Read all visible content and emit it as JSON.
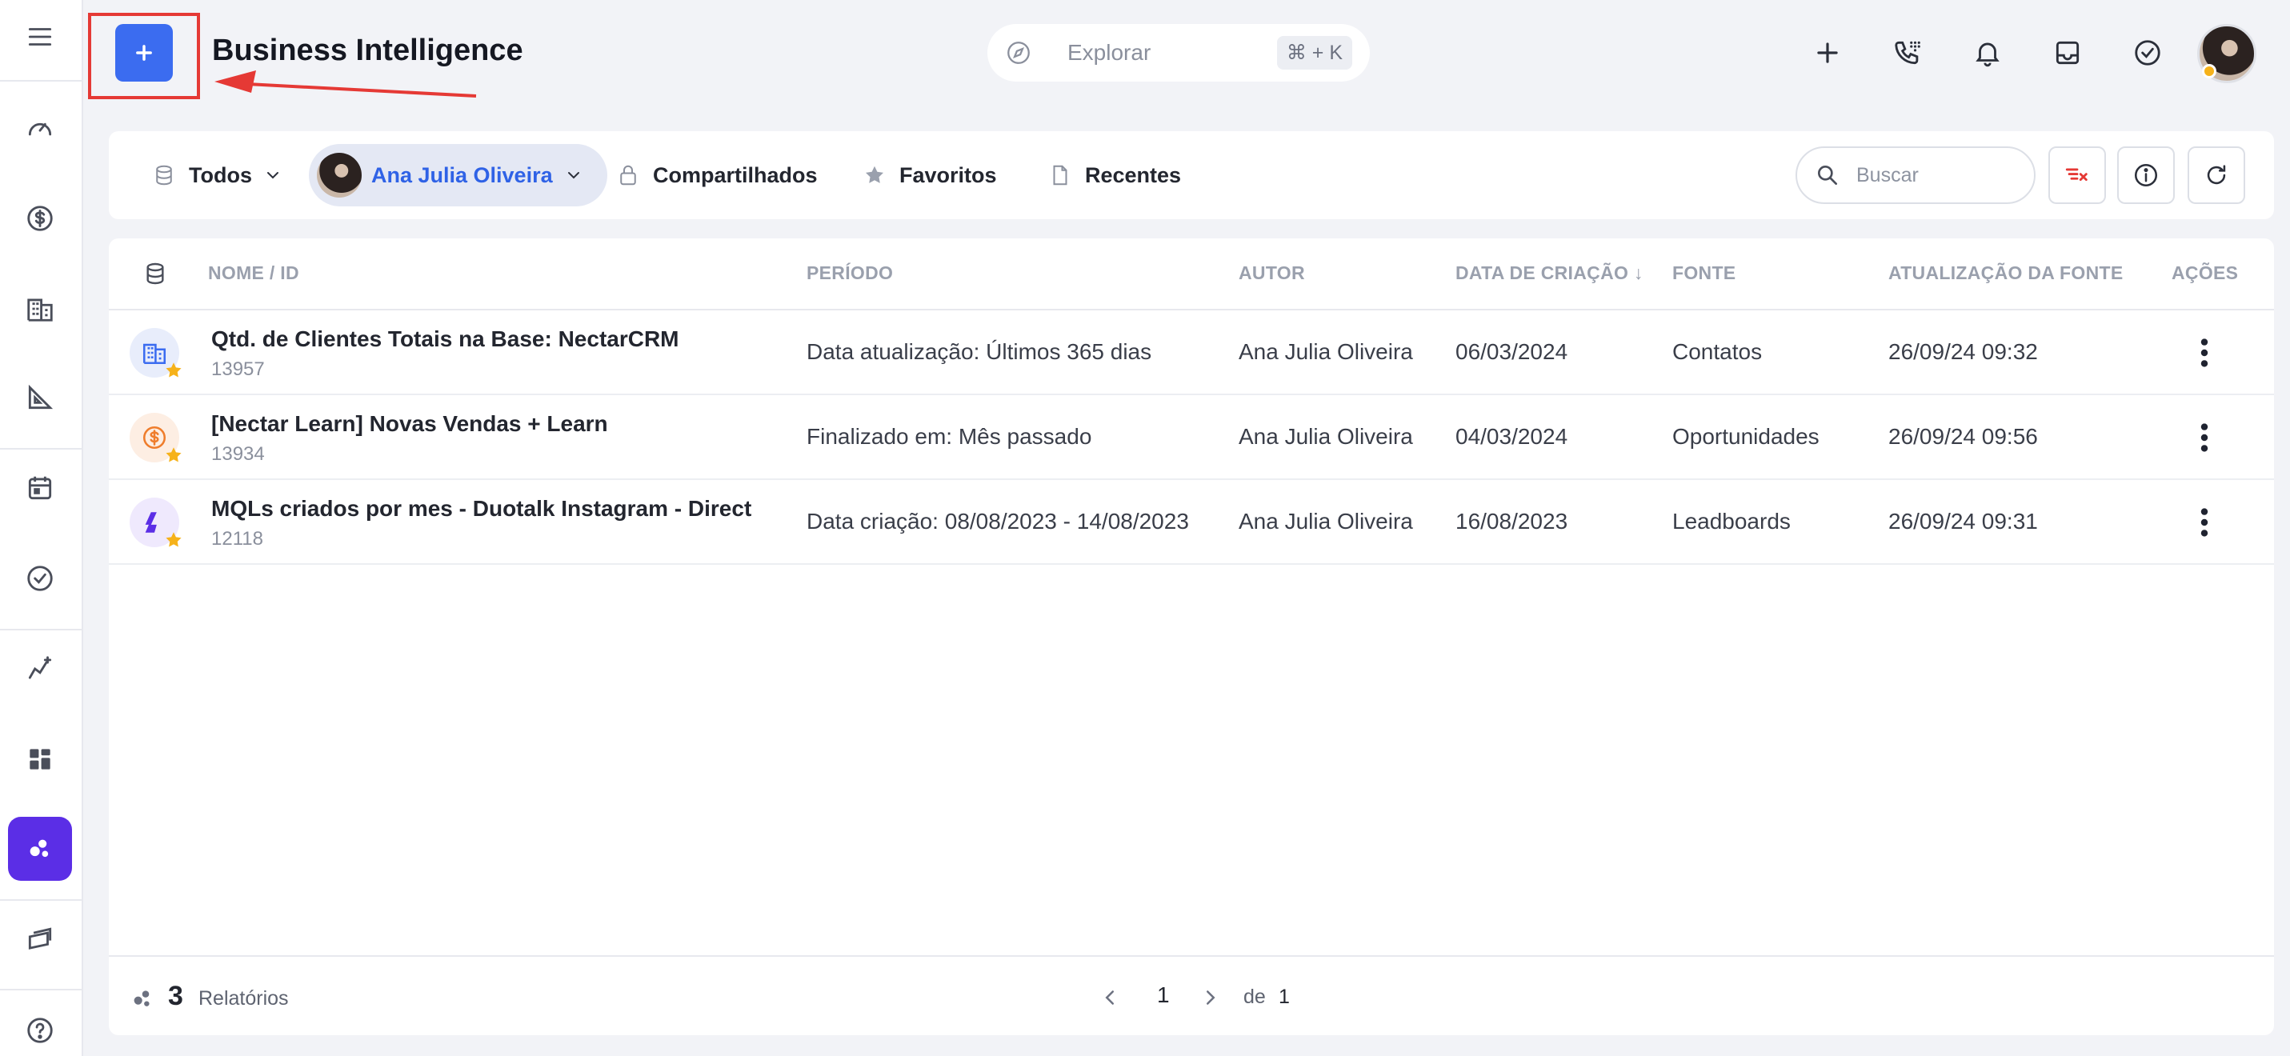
{
  "header": {
    "title": "Business Intelligence",
    "explore_placeholder": "Explorar",
    "shortcut": "⌘ + K"
  },
  "filters": {
    "all": "Todos",
    "user": "Ana Julia Oliveira",
    "shared": "Compartilhados",
    "favorites": "Favoritos",
    "recent": "Recentes",
    "search_placeholder": "Buscar"
  },
  "table": {
    "columns": {
      "name": "NOME / ID",
      "period": "PERÍODO",
      "author": "AUTOR",
      "created": "DATA DE CRIAÇÃO ↓",
      "source": "FONTE",
      "source_updated": "ATUALIZAÇÃO DA FONTE",
      "actions": "AÇÕES"
    },
    "rows": [
      {
        "name": "Qtd. de Clientes Totais na Base: NectarCRM",
        "id": "13957",
        "period": "Data atualização: Últimos 365 dias",
        "author": "Ana Julia Oliveira",
        "created": "06/03/2024",
        "source": "Contatos",
        "source_updated": "26/09/24 09:32",
        "icon": "building-icon"
      },
      {
        "name": "[Nectar Learn] Novas Vendas + Learn",
        "id": "13934",
        "period": "Finalizado em: Mês passado",
        "author": "Ana Julia Oliveira",
        "created": "04/03/2024",
        "source": "Oportunidades",
        "source_updated": "26/09/24 09:56",
        "icon": "dollar-icon"
      },
      {
        "name": "MQLs criados por mes - Duotalk Instagram - Direct",
        "id": "12118",
        "period": "Data criação: 08/08/2023 - 14/08/2023",
        "author": "Ana Julia Oliveira",
        "created": "16/08/2023",
        "source": "Leadboards",
        "source_updated": "26/09/24 09:31",
        "icon": "leadboard-icon"
      }
    ]
  },
  "footer": {
    "count": "3",
    "count_label": "Relatórios",
    "page": "1",
    "of_label": "de",
    "total_pages": "1"
  },
  "colors": {
    "accent": "#3b6cf0",
    "active_sidebar": "#5b2ee6",
    "annotation": "#e53935"
  }
}
